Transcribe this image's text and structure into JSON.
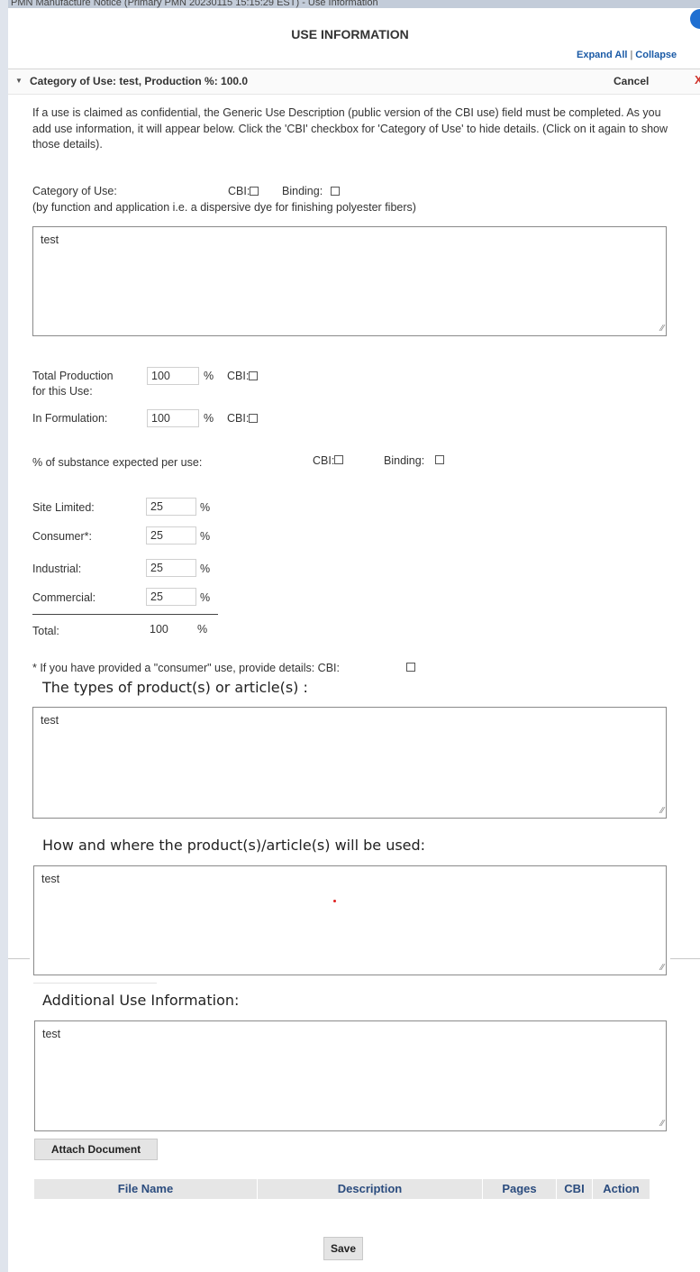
{
  "window": {
    "breadcrumb": "PMN Manufacture Notice (Primary PMN 20230115 15:15:29 EST) - Use Information",
    "title": "USE INFORMATION",
    "expand_all": "Expand All",
    "separator": "|",
    "collapse": "Collapse"
  },
  "section": {
    "title": "Category of Use: test, Production %: 100.0",
    "cancel": "Cancel",
    "close": "X"
  },
  "intro_text": "If a use is claimed as confidential, the Generic Use Description (public version of the CBI use) field must be completed. As you add use information, it will appear below. Click the 'CBI' checkbox for 'Category of Use' to hide details. (Click on it again to show those details).",
  "category_of_use": {
    "label": "Category of Use:",
    "cbi_label": "CBI:",
    "binding_label": "Binding:",
    "hint": "(by function and application i.e. a dispersive dye for finishing polyester fibers)",
    "value": "test"
  },
  "production": {
    "total_label_1": "Total Production",
    "total_label_2": "for this Use:",
    "total_value": "100",
    "formulation_label": "In Formulation:",
    "formulation_value": "100",
    "percent": "%",
    "cbi_label": "CBI:"
  },
  "substance": {
    "label": "% of substance expected per use:",
    "cbi_label": "CBI:",
    "binding_label": "Binding:",
    "rows": [
      {
        "label": "Site Limited:",
        "value": "25"
      },
      {
        "label": "Consumer*:",
        "value": "25"
      },
      {
        "label": "Industrial:",
        "value": "25"
      },
      {
        "label": "Commercial:",
        "value": "25"
      }
    ],
    "percent": "%",
    "total_label": "Total:",
    "total_value": "100"
  },
  "consumer": {
    "note": "* If you have provided a \"consumer\" use, provide details: CBI:",
    "types_label": "The types of product(s) or article(s)  :",
    "types_value": "test",
    "how_label": "How and where the product(s)/article(s) will be used:",
    "how_value": "test"
  },
  "additional": {
    "label": "Additional Use Information:",
    "value": "test"
  },
  "attach_button": "Attach Document",
  "documents_table": {
    "headers": [
      "File Name",
      "Description",
      "Pages",
      "CBI",
      "Action"
    ]
  },
  "save_button": "Save",
  "icons": {
    "help": "help-circle-icon",
    "caret": "caret-down-icon",
    "close": "close-icon",
    "resize": "resize-grip-icon"
  },
  "colors": {
    "link": "#1a5aa6",
    "table_header_text": "#2b4c7e",
    "close": "#d0342c"
  }
}
